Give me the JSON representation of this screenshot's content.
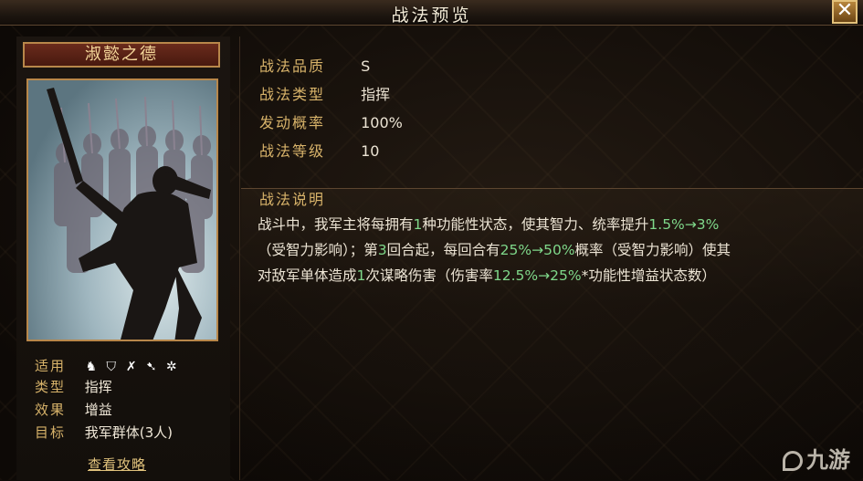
{
  "window": {
    "title": "战法预览",
    "close_label": "✕"
  },
  "skill_name": "淑懿之德",
  "left_info": {
    "applicable_label": "适用",
    "arms_icons": [
      "cavalry-icon",
      "shield-icon",
      "bow-icon",
      "spear-icon",
      "siege-icon"
    ],
    "type_label": "类型",
    "type_value": "指挥",
    "effect_label": "效果",
    "effect_value": "增益",
    "target_label": "目标",
    "target_value": "我军群体(3人)"
  },
  "strategy_link": "查看攻略",
  "attributes": [
    {
      "label": "战法品质",
      "value": "S"
    },
    {
      "label": "战法类型",
      "value": "指挥"
    },
    {
      "label": "发动概率",
      "value": "100%"
    },
    {
      "label": "战法等级",
      "value": "10"
    }
  ],
  "description": {
    "title": "战法说明",
    "line1": [
      "战斗中，我军主将每拥有",
      "1",
      "种功能性状态，使其智力、统率提升",
      "1.5%→3%"
    ],
    "line2": [
      "（受智力影响）；第",
      "3",
      "回合起，每回合有",
      "25%→50%",
      "概率（受智力影响）使其"
    ],
    "line3": [
      "对敌军单体造成",
      "1",
      "次谋略伤害（伤害率",
      "12.5%→25%",
      "*功能性增益状态数）"
    ]
  },
  "watermark": "九游",
  "colors": {
    "gold": "#d8b36a",
    "green": "#7fd88a",
    "frame": "#b8874a"
  }
}
